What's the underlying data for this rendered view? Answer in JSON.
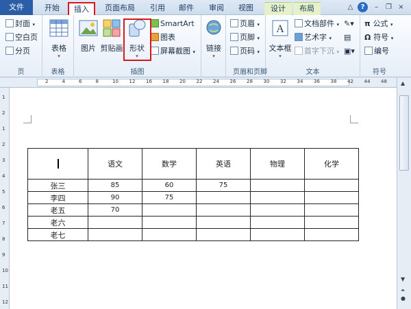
{
  "tabs": {
    "file": "文件",
    "home": "开始",
    "insert": "插入",
    "page_layout": "页面布局",
    "references": "引用",
    "mailings": "邮件",
    "review": "审阅",
    "view": "视图",
    "design": "设计",
    "layout": "布局"
  },
  "window_controls": {
    "collapse": "△",
    "help": "?",
    "minimize": "–",
    "restore": "❐",
    "close": "×"
  },
  "ribbon": {
    "pages": {
      "label": "页",
      "cover": "封面",
      "blank": "空白页",
      "break": "分页"
    },
    "tables": {
      "label": "表格",
      "table": "表格"
    },
    "illustrations": {
      "label": "插图",
      "picture": "图片",
      "clipart": "剪贴画",
      "shapes": "形状",
      "smartart": "SmartArt",
      "chart": "图表",
      "screenshot": "屏幕截图"
    },
    "links": {
      "link": "链接"
    },
    "header_footer": {
      "label": "页眉和页脚",
      "header": "页眉",
      "footer": "页脚",
      "page_number": "页码"
    },
    "text": {
      "label": "文本",
      "textbox": "文本框",
      "quickparts": "文档部件",
      "wordart": "艺术字",
      "dropcap": "首字下沉"
    },
    "symbols": {
      "label": "符号",
      "equation": "公式",
      "symbol": "符号",
      "number": "编号"
    }
  },
  "ruler": {
    "marks": [
      "2",
      "4",
      "6",
      "8",
      "10",
      "12",
      "16",
      "18",
      "20",
      "22",
      "24",
      "26",
      "28",
      "30",
      "32",
      "34",
      "36",
      "38",
      "42",
      "44",
      "48"
    ]
  },
  "vruler": {
    "marks": [
      "1",
      "2",
      "1",
      "2",
      "3",
      "4",
      "5",
      "6",
      "7",
      "8",
      "9",
      "10",
      "11",
      "12"
    ]
  },
  "table": {
    "headers": [
      "",
      "语文",
      "数学",
      "英语",
      "物理",
      "化学"
    ],
    "rows": [
      [
        "张三",
        "85",
        "60",
        "75",
        "",
        ""
      ],
      [
        "李四",
        "90",
        "75",
        "",
        "",
        ""
      ],
      [
        "老五",
        "70",
        "",
        "",
        "",
        ""
      ],
      [
        "老六",
        "",
        "",
        "",
        "",
        ""
      ],
      [
        "老七",
        "",
        "",
        "",
        "",
        ""
      ]
    ]
  },
  "colors": {
    "highlight": "#d9161b",
    "file_tab": "#2a5fa8",
    "ribbon_bg": "#e7eef7"
  }
}
